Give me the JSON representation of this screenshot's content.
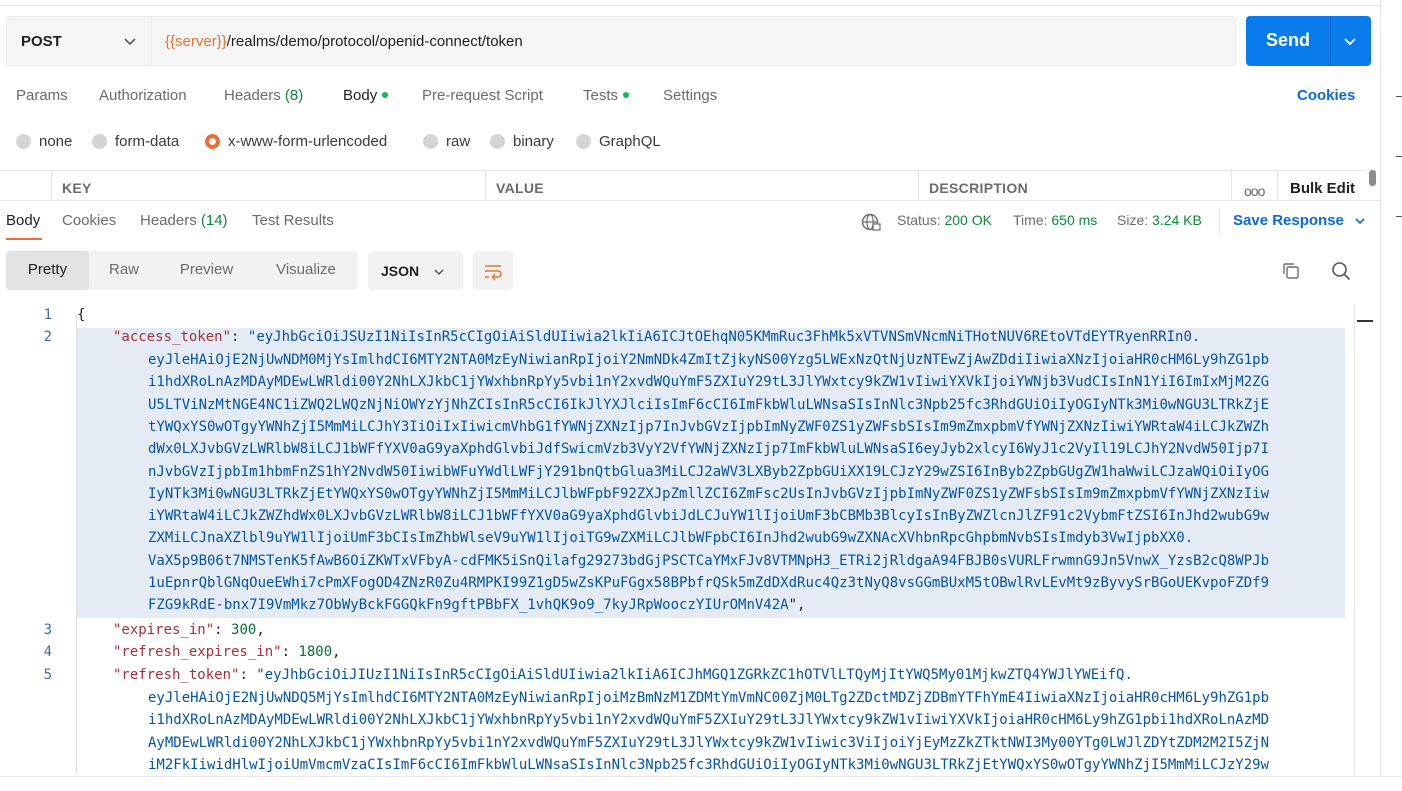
{
  "request": {
    "method": "POST",
    "url_var": "{{server}}",
    "url_path": "/realms/demo/protocol/openid-connect/token",
    "send_label": "Send"
  },
  "req_tabs": [
    {
      "label": "Params"
    },
    {
      "label": "Authorization"
    },
    {
      "label": "Headers",
      "count": "(8)"
    },
    {
      "label": "Body"
    },
    {
      "label": "Pre-request Script"
    },
    {
      "label": "Tests"
    },
    {
      "label": "Settings"
    }
  ],
  "cookies_label": "Cookies",
  "body_types": [
    "none",
    "form-data",
    "x-www-form-urlencoded",
    "raw",
    "binary",
    "GraphQL"
  ],
  "kv_table": {
    "key": "KEY",
    "value": "VALUE",
    "description": "DESCRIPTION",
    "more": "ooo",
    "bulk_edit": "Bulk Edit"
  },
  "resp_tabs": [
    {
      "label": "Body"
    },
    {
      "label": "Cookies"
    },
    {
      "label": "Headers",
      "count": "(14)"
    },
    {
      "label": "Test Results"
    }
  ],
  "response_meta": {
    "status_label": "Status:",
    "status_value": "200 OK",
    "time_label": "Time:",
    "time_value": "650 ms",
    "size_label": "Size:",
    "size_value": "3.24 KB",
    "save_label": "Save Response"
  },
  "view_modes": [
    "Pretty",
    "Raw",
    "Preview",
    "Visualize"
  ],
  "format": "JSON",
  "code": {
    "line_numbers": [
      "1",
      "2",
      "3",
      "4",
      "5"
    ],
    "open_brace": "{",
    "access_key": "\"access_token\"",
    "access_lines": [
      "eyJhbGciOiJSUzI1NiIsInR5cCIgOiAiSldUIiwia2lkIiA6ICJtOEhqN05KMmRuc3FhMk5xVTVNSmVNcmNiTHotNUV6REtoVTdEYTRyenRRIn0.",
      "eyJleHAiOjE2NjUwNDM0MjYsImlhdCI6MTY2NTA0MzEyNiwianRpIjoiY2NmNDk4ZmItZjkyNS00Yzg5LWExNzQtNjUzNTEwZjAwZDdiIiwiaXNzIjoiaHR0cHM6Ly9hZG1pb",
      "i1hdXRoLnAzMDAyMDEwLWRldi00Y2NhLXJkbC1jYWxhbnRpYy5vbi1nY2xvdWQuYmF5ZXIuY29tL3JlYWxtcy9kZW1vIiwiYXVkIjoiYWNjb3VudCIsInN1YiI6ImIxMjM2ZG",
      "U5LTViNzMtNGE4NC1iZWQ2LWQzNjNiOWYzYjNhZCIsInR5cCI6IkJlYXJlciIsImF6cCI6ImFkbWluLWNsaSIsInNlc3Npb25fc3RhdGUiOiIyOGIyNTk3Mi0wNGU3LTRkZjE",
      "tYWQxYS0wOTgyYWNhZjI5MmMiLCJhY3IiOiIxIiwicmVhbG1fYWNjZXNzIjp7InJvbGVzIjpbImNyZWF0ZS1yZWFsbSIsIm9mZmxpbmVfYWNjZXNzIiwiYWRtaW4iLCJkZWZh",
      "dWx0LXJvbGVzLWRlbW8iLCJ1bWFfYXV0aG9yaXphdGlvbiJdfSwicmVzb3VyY2VfYWNjZXNzIjp7ImFkbWluLWNsaSI6eyJyb2xlcyI6WyJ1c2VyIl19LCJhY2NvdW50Ijp7I",
      "nJvbGVzIjpbIm1hbmFnZS1hY2NvdW50IiwibWFuYWdlLWFjY291bnQtbGlua3MiLCJ2aWV3LXByb2ZpbGUiXX19LCJzY29wZSI6InByb2ZpbGUgZW1haWwiLCJzaWQiOiIyOG",
      "IyNTk3Mi0wNGU3LTRkZjEtYWQxYS0wOTgyYWNhZjI5MmMiLCJlbWFpbF92ZXJpZmllZCI6ZmFsc2UsInJvbGVzIjpbImNyZWF0ZS1yZWFsbSIsIm9mZmxpbmVfYWNjZXNzIiw",
      "iYWRtaW4iLCJkZWZhdWx0LXJvbGVzLWRlbW8iLCJ1bWFfYXV0aG9yaXphdGlvbiJdLCJuYW1lIjoiUmF3bCBMb3BlcyIsInByZWZlcnJlZF91c2VybmFtZSI6InJhd2wubG9w",
      "ZXMiLCJnaXZlbl9uYW1lIjoiUmF3bCIsImZhbWlseV9uYW1lIjoiTG9wZXMiLCJlbWFpbCI6InJhd2wubG9wZXNAcXVhbnRpcGhpbmNvbSIsImdyb3VwIjpbXX0.",
      "VaX5p9B06t7NMSTenK5fAwB6OiZKWTxVFbyA-cdFMK5iSnQilafg29273bdGjPSCTCaYMxFJv8VTMNpH3_ETRi2jRldgaA94FBJB0sVURLFrwmnG9Jn5VnwX_YzsB2cQ8WPJb",
      "1uEpnrQblGNqOueEWhi7cPmXFogOD4ZNzR0Zu4RMPKI99Z1gD5wZsKPuFGgx58BPbfrQSk5mZdDXdRuc4Qz3tNyQ8vsGGmBUxM5tOBwlRvLEvMt9zByvySrBGoUEKvpoFZDf9",
      "FZG9kRdE-bnx7I9VmMkz7ObWyBckFGGQkFn9gftPBbFX_1vhQK9o9_7kyJRpWooczYIUrOMnV42A"
    ],
    "expires_key": "\"expires_in\"",
    "expires_value": "300",
    "refresh_expires_key": "\"refresh_expires_in\"",
    "refresh_expires_value": "1800",
    "refresh_key": "\"refresh_token\"",
    "refresh_lines": [
      "\"eyJhbGciOiJIUzI1NiIsInR5cCIgOiAiSldUIiwia2lkIiA6ICJhMGQ1ZGRkZC1hOTVlLTQyMjItYWQ5My01MjkwZTQ4YWJlYWEifQ.",
      "eyJleHAiOjE2NjUwNDQ5MjYsImlhdCI6MTY2NTA0MzEyNiwianRpIjoiMzBmNzM1ZDMtYmVmNC00ZjM0LTg2ZDctMDZjZDBmYTFhYmE4IiwiaXNzIjoiaHR0cHM6Ly9hZG1pb",
      "i1hdXRoLnAzMDAyMDEwLWRldi00Y2NhLXJkbC1jYWxhbnRpYy5vbi1nY2xvdWQuYmF5ZXIuY29tL3JlYWxtcy9kZW1vIiwiYXVkIjoiaHR0cHM6Ly9hZG1pbi1hdXRoLnAzMD",
      "AyMDEwLWRldi00Y2NhLXJkbC1jYWxhbnRpYy5vbi1nY2xvdWQuYmF5ZXIuY29tL3JlYWxtcy9kZW1vIiwic3ViIjoiYjEyMzZkZTktNWI3My00YTg0LWJlZDYtZDM2M2I5ZjN",
      "iM2FkIiwidHlwIjoiUmVmcmVzaCIsImF6cCI6ImFkbWluLWNsaSIsInNlc3Npb25fc3RhdGUiOiIyOGIyNTk3Mi0wNGU3LTRkZjEtYWQxYS0wOTgyYWNhZjI5MmMiLCJzY29w"
    ]
  }
}
